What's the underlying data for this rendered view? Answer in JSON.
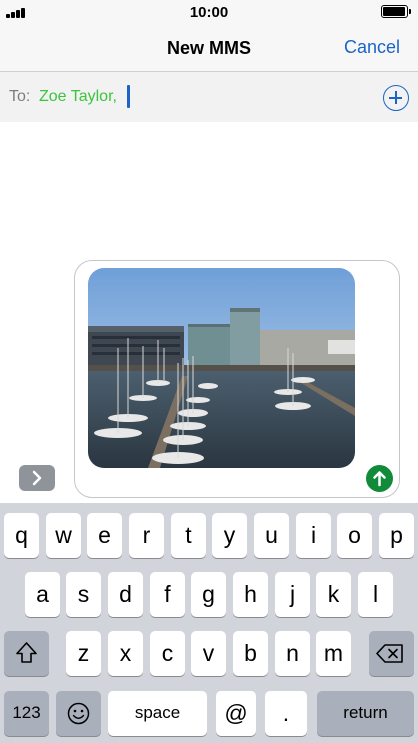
{
  "status_bar": {
    "time": "10:00",
    "battery_level": 1.0
  },
  "nav": {
    "title": "New MMS",
    "cancel_label": "Cancel"
  },
  "to_field": {
    "label": "To:",
    "recipient": "Zoe Taylor,"
  },
  "compose": {
    "attachment_icon": "photo-harbour",
    "send_icon": "arrow-up-icon",
    "expand_icon": "chevron-right-icon"
  },
  "keyboard": {
    "row1": [
      "q",
      "w",
      "e",
      "r",
      "t",
      "y",
      "u",
      "i",
      "o",
      "p"
    ],
    "row2": [
      "a",
      "s",
      "d",
      "f",
      "g",
      "h",
      "j",
      "k",
      "l"
    ],
    "row3": [
      "z",
      "x",
      "c",
      "v",
      "b",
      "n",
      "m"
    ],
    "shift_icon": "shift-icon",
    "delete_icon": "backspace-icon",
    "numbers_label": "123",
    "emoji_icon": "emoji-icon",
    "space_label": "space",
    "at_label": "@",
    "period_label": ".",
    "return_label": "return"
  },
  "colors": {
    "accent": "#1a64c8",
    "recipient": "#3cc43c",
    "send": "#118a3a",
    "keyboard_bg": "#d1d5db"
  }
}
